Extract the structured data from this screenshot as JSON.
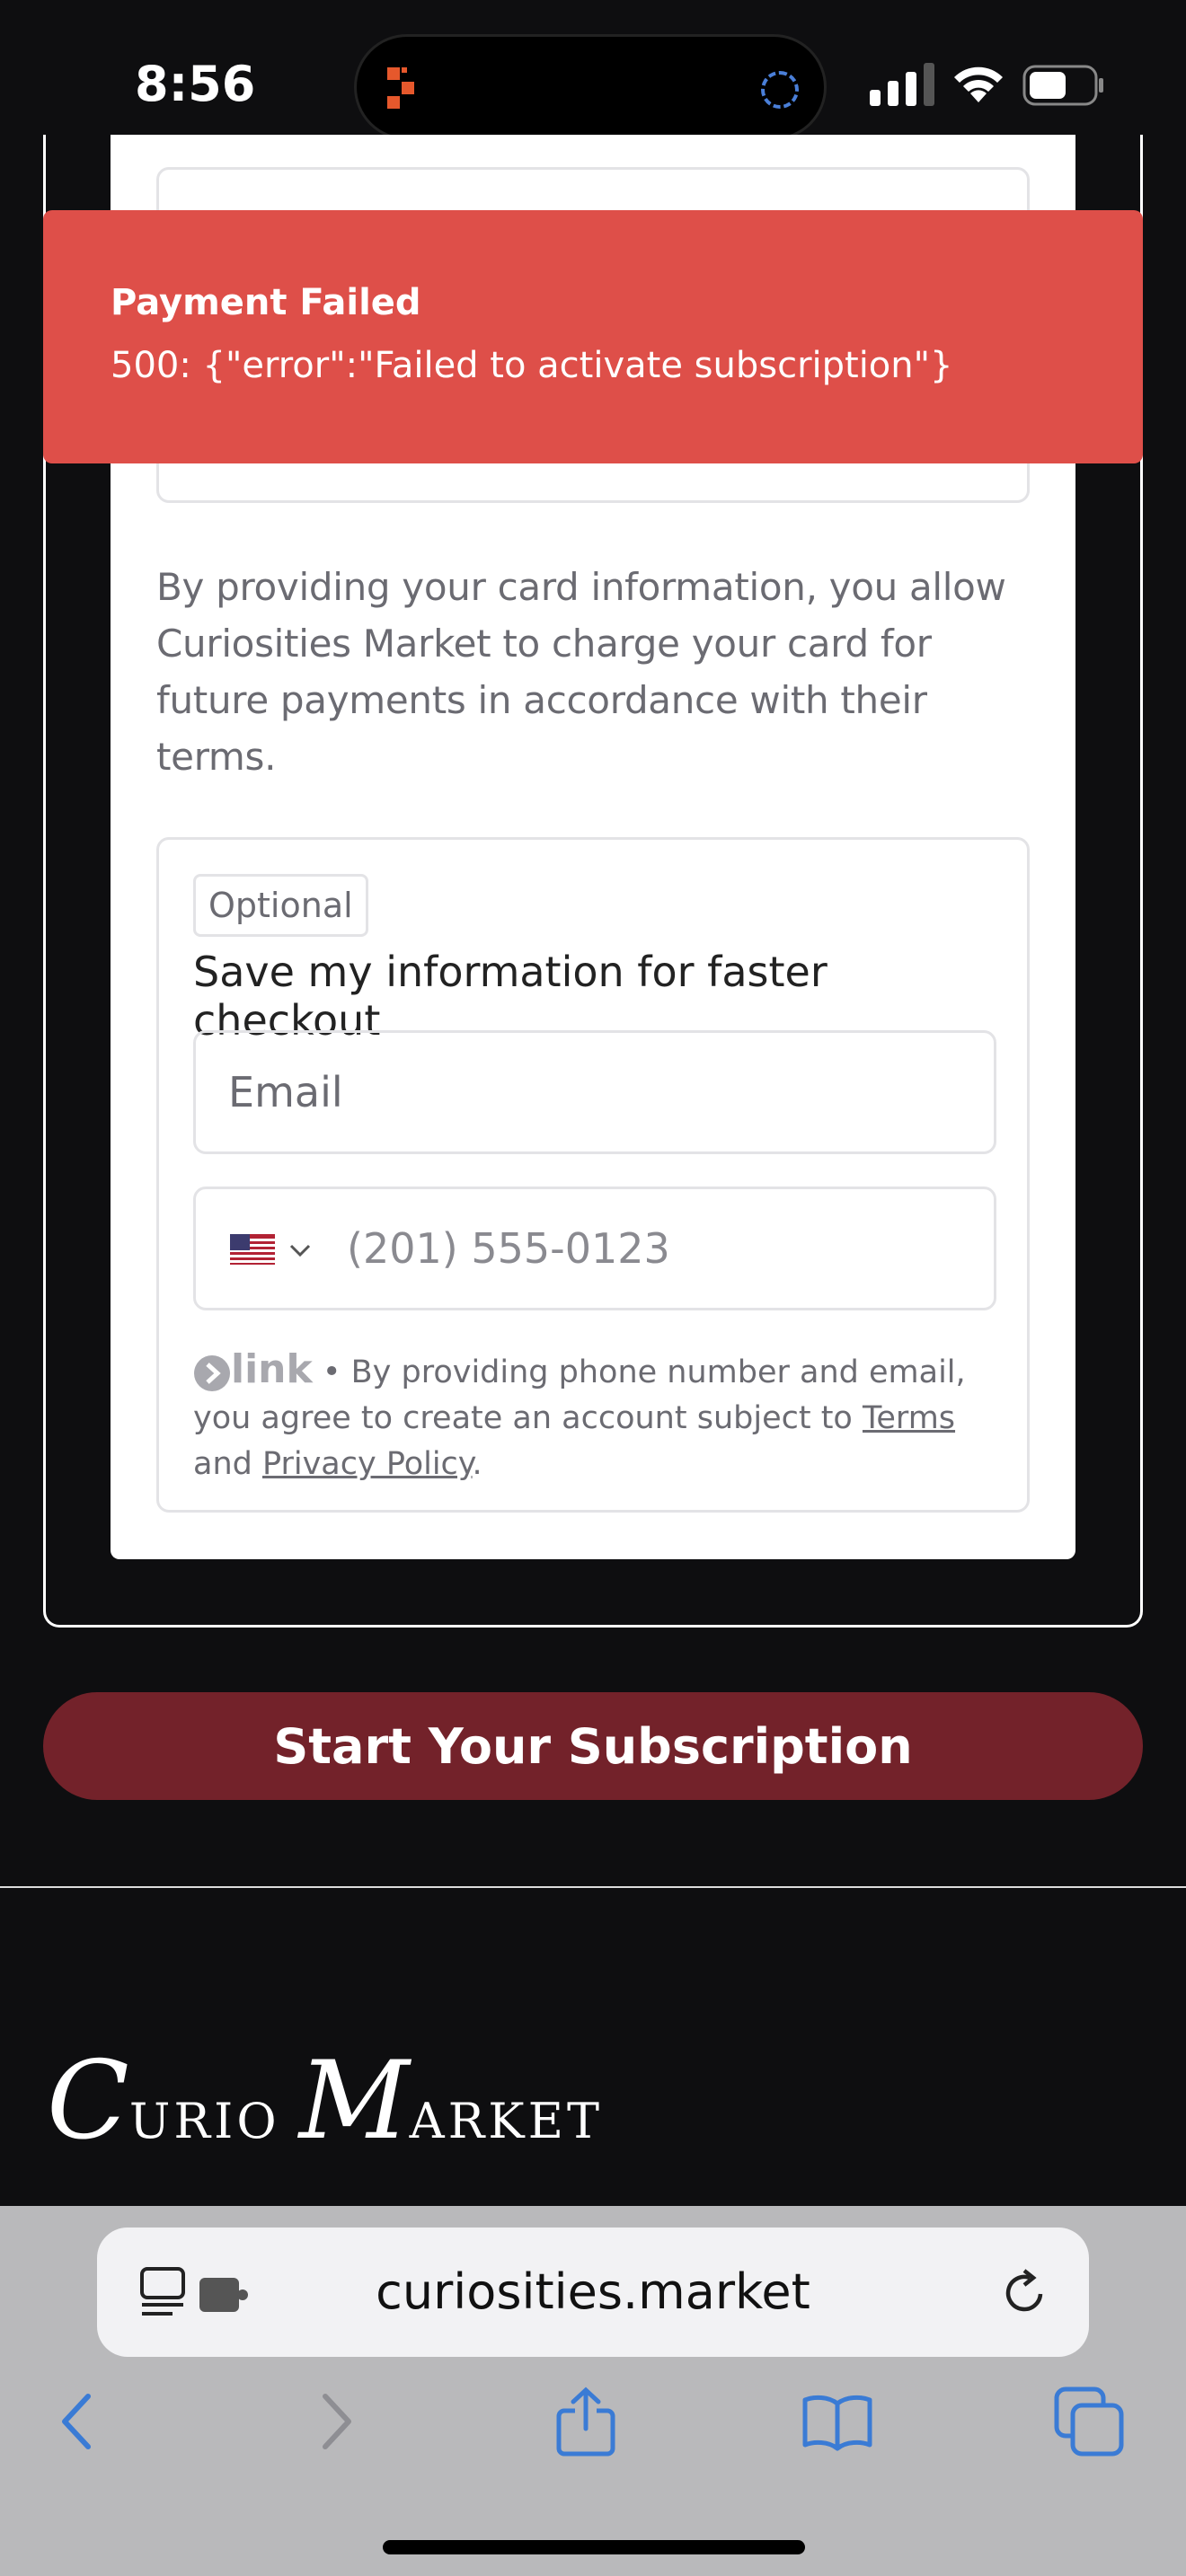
{
  "status_bar": {
    "time": "8:56"
  },
  "toast": {
    "title": "Payment Failed",
    "message": "500: {\"error\":\"Failed to activate subscription\"}"
  },
  "form": {
    "consent_text": "By providing your card information, you allow Curiosities Market to charge your card for future payments in accordance with their terms.",
    "link_section": {
      "badge": "Optional",
      "title": "Save my information for faster checkout",
      "email_placeholder": "Email",
      "phone_placeholder": "(201) 555-0123",
      "brand_word": "link",
      "legal_prefix": " • By providing phone number and email, you agree to create an account subject to ",
      "terms_label": "Terms",
      "and_label": " and ",
      "privacy_label": "Privacy Policy",
      "legal_suffix": "."
    }
  },
  "cta": {
    "label": "Start Your Subscription"
  },
  "footer": {
    "brand_c": "C",
    "brand_urio": "URIO ",
    "brand_m": "M",
    "brand_arket": "ARKET"
  },
  "safari": {
    "url": "curiosities.market"
  },
  "colors": {
    "toast": "#de4f49",
    "cta": "#73222a",
    "safari_blue": "#3a7bd5"
  }
}
